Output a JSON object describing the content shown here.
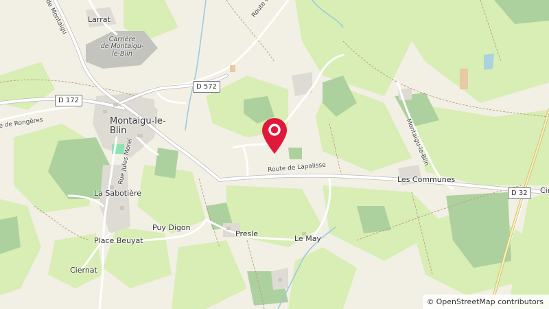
{
  "map": {
    "places": {
      "larrat": "Larrat",
      "montaigu_line1": "Montaigu-le-",
      "montaigu_line2": "Blin",
      "la_sabotiere": "La Sabotière",
      "puy_digon": "Puy Digon",
      "place_beuyat": "Place Beuyat",
      "presle": "Presle",
      "le_may": "Le May",
      "ciernat": "Ciernat",
      "les_communes": "Les Communes",
      "cin": "Cin"
    },
    "quarry": {
      "line1": "Carrière",
      "line2": "de Montaigu-",
      "line3": "le-Blin"
    },
    "roads": {
      "route_de_cindre": "Route de Cindré",
      "route_de_rongeres": "e de Rongères",
      "rue_jules_morel": "Rue Jules Morel",
      "route_de_lapalisse": "Route de Lapalisse",
      "route_de_montaigu": "Route de Montaigu",
      "montaigu_le_blin_vertical": "Montaigu-le-Blin",
      "de_montaigu_top": "de Montaigu"
    },
    "shields": {
      "d572": "D 572",
      "d172": "D 172",
      "d32": "D 32"
    },
    "marker": {
      "icon": "map-pin-icon",
      "color": "#e0193a"
    }
  },
  "attribution": {
    "symbol": "©",
    "link_text": "OpenStreetMap contributors"
  }
}
